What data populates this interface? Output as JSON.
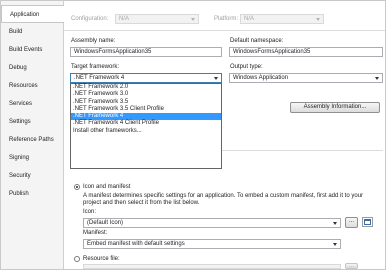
{
  "sidebar": {
    "items": [
      {
        "label": "Application"
      },
      {
        "label": "Build"
      },
      {
        "label": "Build Events"
      },
      {
        "label": "Debug"
      },
      {
        "label": "Resources"
      },
      {
        "label": "Services"
      },
      {
        "label": "Settings"
      },
      {
        "label": "Reference Paths"
      },
      {
        "label": "Signing"
      },
      {
        "label": "Security"
      },
      {
        "label": "Publish"
      }
    ],
    "active_index": 0
  },
  "toolbar": {
    "configuration_label": "Configuration:",
    "configuration_value": "N/A",
    "platform_label": "Platform:",
    "platform_value": "N/A"
  },
  "form": {
    "assembly_name_label": "Assembly name:",
    "assembly_name_value": "WindowsFormsApplication35",
    "default_namespace_label": "Default namespace:",
    "default_namespace_value": "WindowsFormsApplication35",
    "target_framework_label": "Target framework:",
    "target_framework_value": ".NET Framework 4",
    "output_type_label": "Output type:",
    "output_type_value": "Windows Application",
    "assembly_info_button": "Assembly Information..."
  },
  "framework_dropdown": {
    "options": [
      ".NET Framework 2.0",
      ".NET Framework 3.0",
      ".NET Framework 3.5",
      ".NET Framework 3.5 Client Profile",
      ".NET Framework 4",
      ".NET Framework 4 Client Profile",
      "Install other frameworks..."
    ],
    "selected_index": 4
  },
  "resources": {
    "icon_manifest_label": "Icon and manifest",
    "description": "A manifest determines specific settings for an application. To embed a custom manifest, first add it to your project and then select it from the list below.",
    "icon_label": "Icon:",
    "icon_value": "(Default Icon)",
    "browse_button": "...",
    "manifest_label": "Manifest:",
    "manifest_value": "Embed manifest with default settings",
    "resource_file_label": "Resource file:",
    "resource_browse_button": "..."
  }
}
